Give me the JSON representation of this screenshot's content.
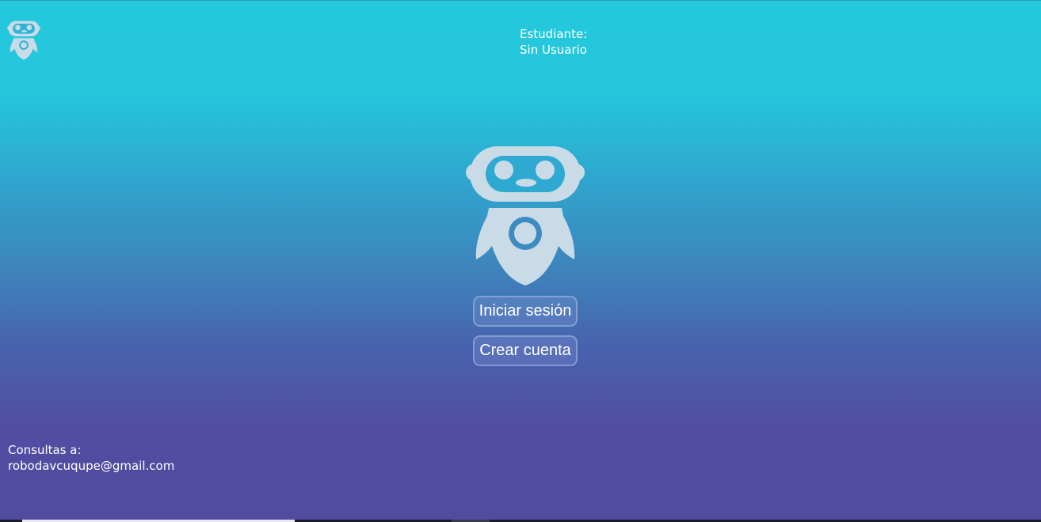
{
  "header": {
    "logo_icon": "robot-icon",
    "student_label": "Estudiante:",
    "student_value": "Sin Usuario"
  },
  "hero": {
    "icon": "robot-icon"
  },
  "actions": {
    "login_label": "Iniciar sesión",
    "signup_label": "Crear cuenta"
  },
  "footer": {
    "contact_label": "Consultas a:",
    "contact_email": "robodavcuqupe@gmail.com"
  },
  "colors": {
    "gradient_top": "#24c8dc",
    "gradient_bottom": "#524ba0",
    "robot": "#c9dbe7",
    "text": "#ffffff"
  }
}
